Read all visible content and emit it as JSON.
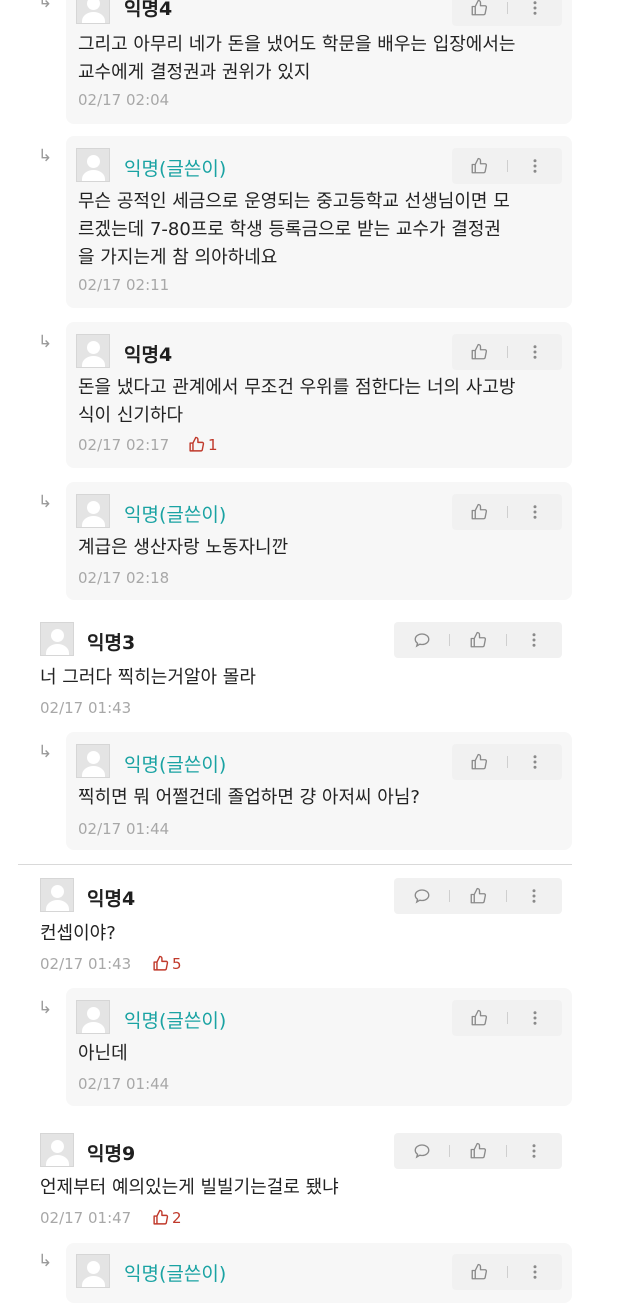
{
  "comments": [
    {
      "name": "익명4",
      "text": "그리고 아무리 네가 돈을 냈어도 학문을 배우는 입장에서는\n교수에게 결정권과 권위가 있지",
      "time": "02/17 02:04"
    },
    {
      "name": "익명(글쓴이)",
      "text": "무슨 공적인 세금으로 운영되는 중고등학교 선생님이면 모\n르겠는데 7-80프로 학생 등록금으로 받는 교수가 결정권\n을 가지는게 참 의아하네요",
      "time": "02/17 02:11"
    },
    {
      "name": "익명4",
      "text": "돈을 냈다고 관계에서 무조건 우위를 점한다는 너의 사고방\n식이 신기하다",
      "time": "02/17 02:17",
      "likes": "1"
    },
    {
      "name": "익명(글쓴이)",
      "text": "계급은 생산자랑 노동자니깐",
      "time": "02/17 02:18"
    },
    {
      "name": "익명3",
      "text": "너 그러다 찍히는거알아 몰라",
      "time": "02/17 01:43"
    },
    {
      "name": "익명(글쓴이)",
      "text": "찍히면 뭐 어쩔건데 졸업하면 걍 아저씨 아님?",
      "time": "02/17 01:44"
    },
    {
      "name": "익명4",
      "text": "컨셉이야?",
      "time": "02/17 01:43",
      "likes": "5"
    },
    {
      "name": "익명(글쓴이)",
      "text": "아닌데",
      "time": "02/17 01:44"
    },
    {
      "name": "익명9",
      "text": "언제부터 예의있는게 빌빌기는걸로 됐냐",
      "time": "02/17 01:47",
      "likes": "2"
    },
    {
      "name": "익명(글쓴이)"
    }
  ],
  "icons": {
    "reply_arrow": "↳",
    "comment": "comment-icon",
    "like": "thumbs-up-icon",
    "more": "more-vertical-icon"
  },
  "colors": {
    "author": "#1aa3a3",
    "like_count": "#c0392b",
    "reply_background": "#f7f7f7",
    "timestamp": "#a8a8a8"
  }
}
